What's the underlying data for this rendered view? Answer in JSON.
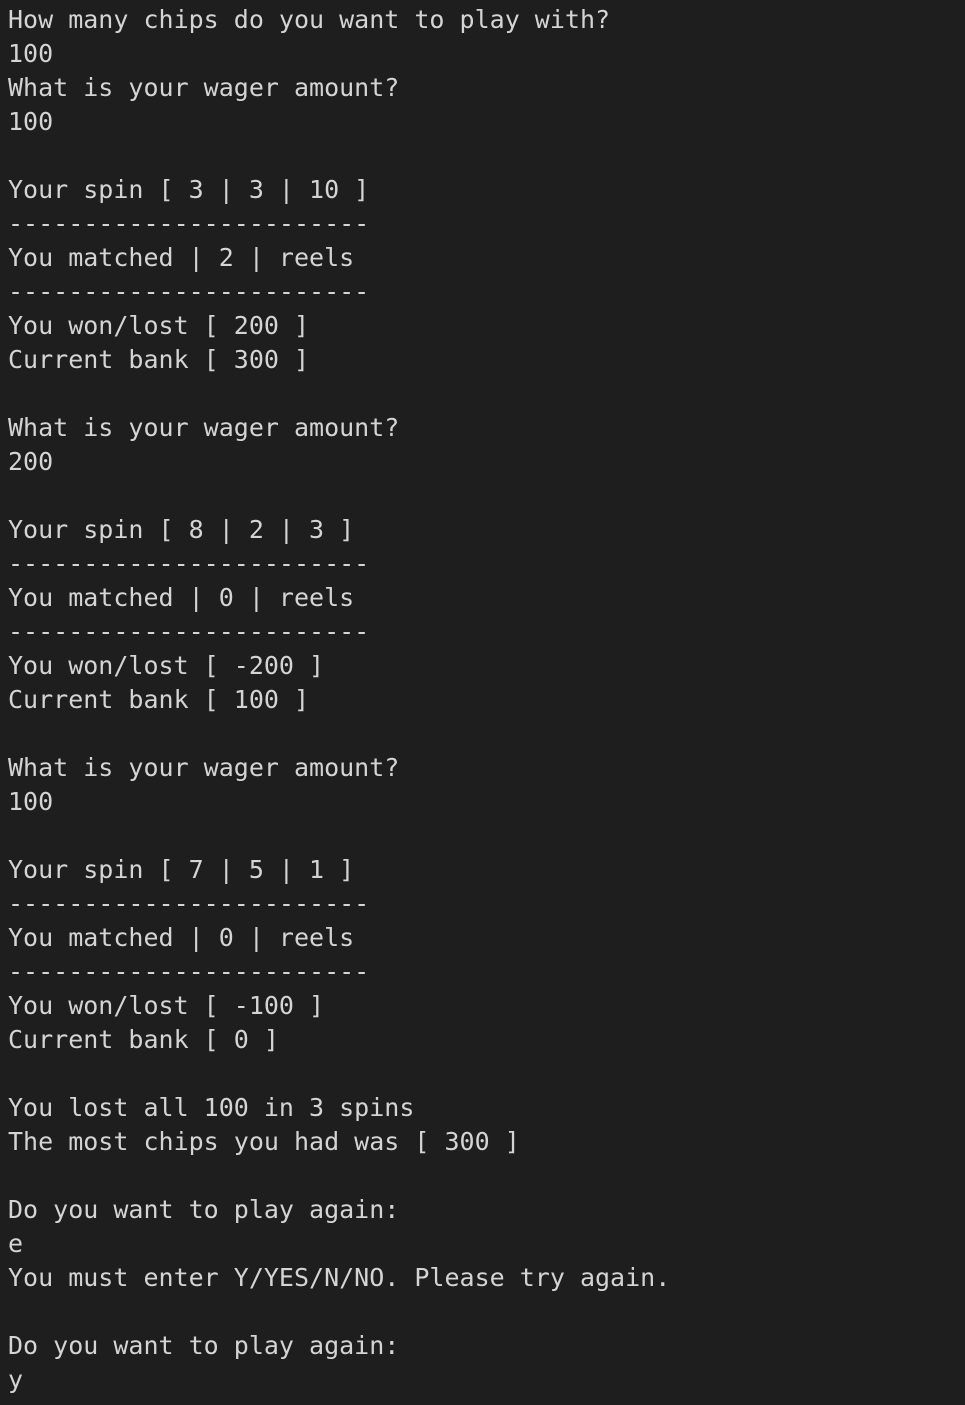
{
  "terminal": {
    "lines": [
      "How many chips do you want to play with?",
      "100",
      "What is your wager amount?",
      "100",
      "",
      "Your spin [ 3 | 3 | 10 ]",
      "------------------------",
      "You matched | 2 | reels",
      "------------------------",
      "You won/lost [ 200 ]",
      "Current bank [ 300 ]",
      "",
      "What is your wager amount?",
      "200",
      "",
      "Your spin [ 8 | 2 | 3 ]",
      "------------------------",
      "You matched | 0 | reels",
      "------------------------",
      "You won/lost [ -200 ]",
      "Current bank [ 100 ]",
      "",
      "What is your wager amount?",
      "100",
      "",
      "Your spin [ 7 | 5 | 1 ]",
      "------------------------",
      "You matched | 0 | reels",
      "------------------------",
      "You won/lost [ -100 ]",
      "Current bank [ 0 ]",
      "",
      "You lost all 100 in 3 spins",
      "The most chips you had was [ 300 ]",
      "",
      "Do you want to play again:",
      "e",
      "You must enter Y/YES/N/NO. Please try again.",
      "",
      "Do you want to play again:",
      "y"
    ]
  }
}
